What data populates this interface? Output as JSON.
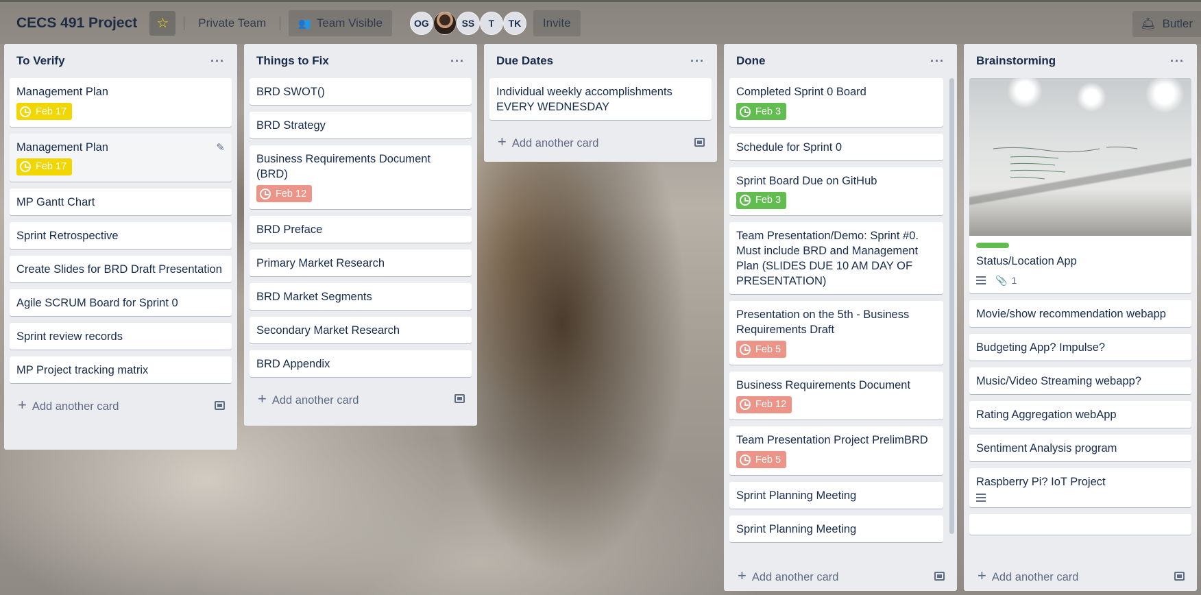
{
  "board": {
    "title": "CECS 491 Project",
    "visibility_team": "Private Team",
    "visibility_label": "Team Visible",
    "invite_label": "Invite",
    "butler_label": "Butler",
    "members": [
      "OG",
      "",
      "SS",
      "T",
      "TK"
    ]
  },
  "colors": {
    "yellow_due": "#f2d600",
    "green_done": "#61bd4f",
    "red_overdue": "#eb5a46"
  },
  "lists": {
    "to_verify": {
      "title": "To Verify",
      "menu": "···",
      "add": "Add another card",
      "cards": [
        {
          "title": "Management Plan",
          "due": "Feb 17"
        },
        {
          "title": "Management Plan",
          "due": "Feb 17"
        },
        {
          "title": "MP Gantt Chart"
        },
        {
          "title": "Sprint Retrospective"
        },
        {
          "title": "Create Slides for BRD Draft Presentation"
        },
        {
          "title": "Agile SCRUM Board for Sprint 0"
        },
        {
          "title": "Sprint review records"
        },
        {
          "title": "MP Project tracking matrix"
        }
      ]
    },
    "things_to_fix": {
      "title": "Things to Fix",
      "menu": "···",
      "add": "Add another card",
      "cards": [
        {
          "title": "BRD SWOT()"
        },
        {
          "title": "BRD Strategy"
        },
        {
          "title": "Business Requirements Document (BRD)",
          "due": "Feb 12"
        },
        {
          "title": "BRD Preface"
        },
        {
          "title": "Primary Market Research"
        },
        {
          "title": "BRD Market Segments"
        },
        {
          "title": "Secondary Market Research"
        },
        {
          "title": "BRD Appendix"
        }
      ]
    },
    "due_dates": {
      "title": "Due Dates",
      "menu": "···",
      "add": "Add another card",
      "cards": [
        {
          "title": "Individual weekly accomplishments EVERY WEDNESDAY"
        }
      ]
    },
    "done": {
      "title": "Done",
      "menu": "···",
      "add": "Add another card",
      "cards": [
        {
          "title": "Completed Sprint 0 Board",
          "due": "Feb 3"
        },
        {
          "title": "Schedule for Sprint 0"
        },
        {
          "title": "Sprint Board Due on GitHub",
          "due": "Feb 3"
        },
        {
          "title": "Team Presentation/Demo: Sprint #0. Must include BRD and Management Plan (SLIDES DUE 10 AM DAY OF PRESENTATION)"
        },
        {
          "title": "Presentation on the 5th - Business Requirements Draft",
          "due": "Feb 5"
        },
        {
          "title": "Business Requirements Document",
          "due": "Feb 12"
        },
        {
          "title": "Team Presentation Project PrelimBRD",
          "due": "Feb 5"
        },
        {
          "title": "Sprint Planning Meeting"
        },
        {
          "title": "Sprint Planning Meeting"
        }
      ]
    },
    "brainstorming": {
      "title": "Brainstorming",
      "menu": "···",
      "add": "Add another card",
      "cards": [
        {
          "title": "Status/Location App",
          "attachments": "1"
        },
        {
          "title": "Movie/show recommendation webapp"
        },
        {
          "title": "Budgeting App? Impulse?"
        },
        {
          "title": "Music/Video Streaming webapp?"
        },
        {
          "title": "Rating Aggregation webApp"
        },
        {
          "title": "Sentiment Analysis program"
        },
        {
          "title": "Raspberry Pi? IoT Project"
        }
      ]
    }
  }
}
